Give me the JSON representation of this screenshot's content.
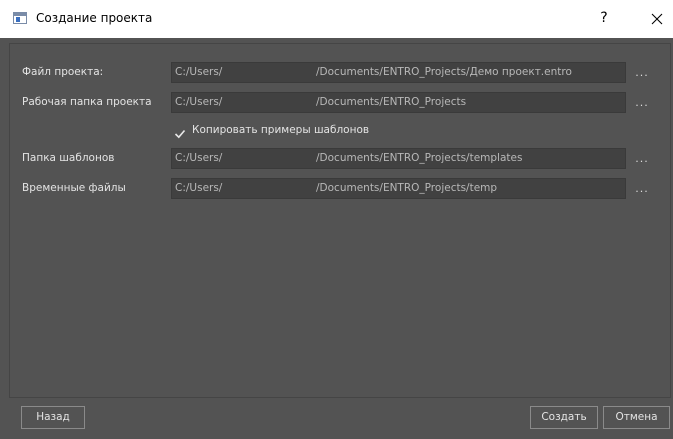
{
  "window": {
    "title": "Создание проекта",
    "help_label": "?"
  },
  "form": {
    "rows": [
      {
        "label": "Файл проекта:",
        "value_part1": "C:/Users/",
        "value_part2": "/Documents/ENTRO_Projects/Демо проект.entro",
        "browse_label": "..."
      },
      {
        "label": "Рабочая папка проекта",
        "value_part1": "C:/Users/",
        "value_part2": "/Documents/ENTRO_Projects",
        "browse_label": "..."
      },
      {
        "label": "Папка шаблонов",
        "value_part1": "C:/Users/",
        "value_part2": "/Documents/ENTRO_Projects/templates",
        "browse_label": "..."
      },
      {
        "label": "Временные файлы",
        "value_part1": "C:/Users/",
        "value_part2": "/Documents/ENTRO_Projects/temp",
        "browse_label": "..."
      }
    ],
    "copy_templates": {
      "label": "Копировать примеры шаблонов",
      "checked": true
    }
  },
  "buttons": {
    "back_label": "Назад",
    "create_label": "Создать",
    "cancel_label": "Отмена"
  },
  "colors": {
    "background": "#535353",
    "field_background": "#414141",
    "text": "#e4e4e4",
    "field_text": "#b8b8b8"
  }
}
